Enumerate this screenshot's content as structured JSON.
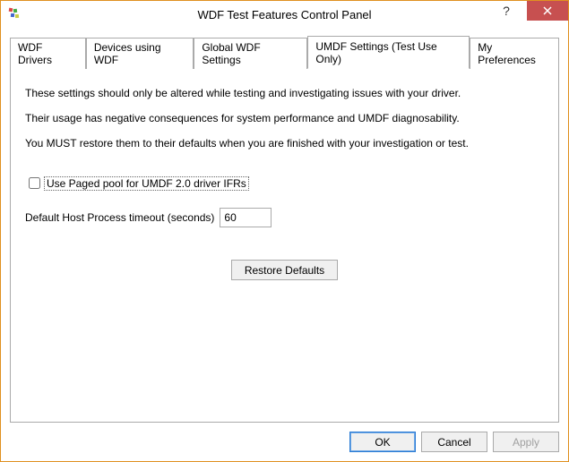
{
  "window": {
    "title": "WDF Test Features Control Panel"
  },
  "tabs": [
    {
      "label": "WDF Drivers"
    },
    {
      "label": "Devices using WDF"
    },
    {
      "label": "Global WDF Settings"
    },
    {
      "label": "UMDF Settings (Test Use Only)"
    },
    {
      "label": "My Preferences"
    }
  ],
  "panel": {
    "intro1": "These settings should only be altered while testing and investigating issues with your driver.",
    "intro2": "Their usage has negative consequences for system performance and UMDF diagnosability.",
    "intro3": "You MUST restore them to their defaults when you are finished with your investigation or test.",
    "checkbox_label": "Use Paged pool for UMDF 2.0 driver IFRs",
    "timeout_label": "Default Host Process timeout (seconds)",
    "timeout_value": "60",
    "restore_label": "Restore Defaults"
  },
  "footer": {
    "ok": "OK",
    "cancel": "Cancel",
    "apply": "Apply"
  }
}
